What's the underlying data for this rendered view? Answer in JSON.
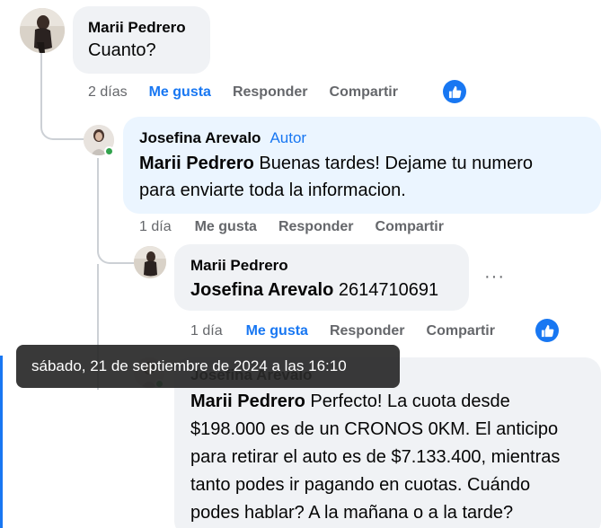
{
  "comments": [
    {
      "author": "Marii Pedrero",
      "text": "Cuanto?",
      "time": "2 días",
      "like_label": "Me gusta",
      "reply_label": "Responder",
      "share_label": "Compartir",
      "liked": true
    },
    {
      "author": "Josefina Arevalo",
      "author_tag": "Autor",
      "mention": "Marii Pedrero",
      "text_line1": " Buenas tardes! Dejame tu numero",
      "text_line2": "para enviarte toda la informacion.",
      "time": "1 día",
      "like_label": "Me gusta",
      "reply_label": "Responder",
      "share_label": "Compartir",
      "online": true
    },
    {
      "author": "Marii Pedrero",
      "mention": "Josefina Arevalo",
      "text": " 2614710691",
      "time": "1 día",
      "like_label": "Me gusta",
      "reply_label": "Responder",
      "share_label": "Compartir",
      "more_label": "···",
      "liked": true
    },
    {
      "author": "Josefina Arevalo",
      "mention": "Marii Pedrero",
      "text_line1": " Perfecto! La cuota desde",
      "text_line2": "$198.000 es de un CRONOS 0KM. El anticipo",
      "text_line3": "para retirar el auto es de $7.133.400, mientras",
      "text_line4": "tanto podes ir pagando en cuotas. Cuándo",
      "text_line5": "podes hablar? A la mañana o a la tarde?",
      "online": true
    }
  ],
  "tooltip": "sábado, 21 de septiembre de 2024 a las 16:10",
  "colors": {
    "accent": "#1877f2",
    "bubble": "#f0f2f5",
    "author_bubble": "#ebf5ff",
    "secondary_text": "#65676b",
    "online": "#31a24c"
  },
  "icons": [
    "thumbs-up-icon",
    "more-options-icon",
    "online-status-icon"
  ]
}
